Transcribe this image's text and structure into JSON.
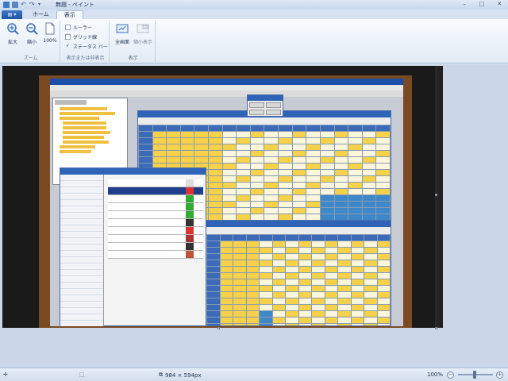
{
  "window": {
    "title": "無題 - ペイント",
    "minimize_glyph": "–",
    "maximize_glyph": "□",
    "close_glyph": "✕"
  },
  "tabs": {
    "app_menu_glyph": "▤ ▾",
    "home": "ホーム",
    "view": "表示"
  },
  "ribbon": {
    "zoom_group": {
      "label": "ズーム",
      "zoom_in": "拡大",
      "zoom_out": "縮小",
      "actual_size": "100%"
    },
    "show_hide_group": {
      "label": "表示または非表示",
      "rulers": "ルーラー",
      "gridlines": "グリッド線",
      "statusbar": "ステータス バー",
      "rulers_checked": false,
      "gridlines_checked": false,
      "statusbar_checked": true
    },
    "display_group": {
      "label": "表示",
      "fullscreen": "全画面",
      "thumbnail": "縮小表示"
    }
  },
  "statusbar": {
    "dimensions": "984 × 594px",
    "zoom": "100%"
  },
  "colors": {
    "accent": "#2f63b8",
    "ribbon_bg": "#f5f8fc",
    "canvas_bg": "#cbd7e8"
  }
}
